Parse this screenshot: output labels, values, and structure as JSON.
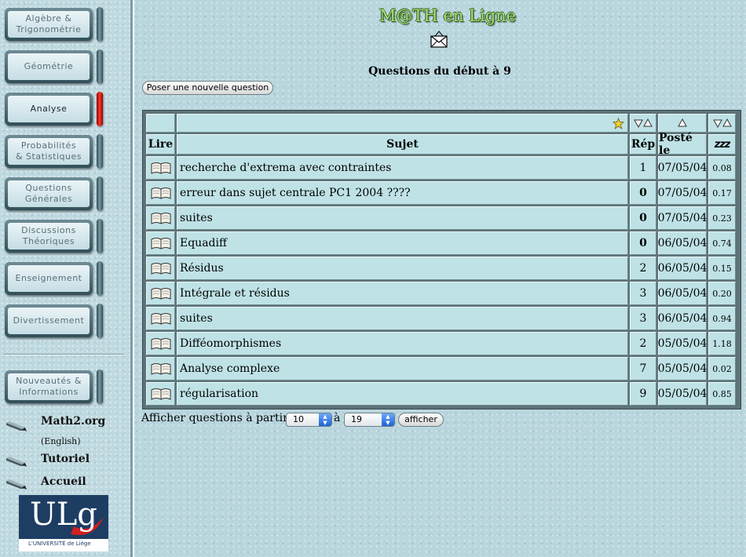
{
  "sidebar": {
    "items": [
      {
        "label": "Algèbre &\nTrigonométrie",
        "active": false
      },
      {
        "label": "Géométrie",
        "active": false
      },
      {
        "label": "Analyse",
        "active": true
      },
      {
        "label": "Probabilités\n& Statistiques",
        "active": false
      },
      {
        "label": "Questions\nGénérales",
        "active": false
      },
      {
        "label": "Discussions\nThéoriques",
        "active": false
      },
      {
        "label": "Enseignement",
        "active": false
      },
      {
        "label": "Divertissement",
        "active": false
      }
    ],
    "news": {
      "label": "Nouveautés &\nInformations"
    },
    "links": {
      "math2": "Math2.org",
      "math2_note": "(English)",
      "tutorial": "Tutoriel",
      "home": "Accueil"
    },
    "logo": {
      "text": "ULg",
      "caption": "L'UNIVERSITÉ de Liège"
    }
  },
  "header": {
    "site_title": "M@TH en Ligne",
    "questions_heading": "Questions du début à 9",
    "new_question_button": "Poser une nouvelle question"
  },
  "table": {
    "columns": {
      "read": "Lire",
      "subject": "Sujet",
      "replies": "Rép",
      "posted": "Posté le",
      "sleep": "zzz"
    },
    "rows": [
      {
        "subject": "recherche d'extrema avec contraintes",
        "replies": "1",
        "date": "07/05/04",
        "score": "0.08"
      },
      {
        "subject": "erreur dans sujet centrale PC1 2004 ????",
        "replies": "0",
        "date": "07/05/04",
        "score": "0.17"
      },
      {
        "subject": "suites",
        "replies": "0",
        "date": "07/05/04",
        "score": "0.23"
      },
      {
        "subject": "Equadiff",
        "replies": "0",
        "date": "06/05/04",
        "score": "0.74"
      },
      {
        "subject": "Résidus",
        "replies": "2",
        "date": "06/05/04",
        "score": "0.15"
      },
      {
        "subject": "Intégrale et résidus",
        "replies": "3",
        "date": "06/05/04",
        "score": "0.20"
      },
      {
        "subject": "suites",
        "replies": "3",
        "date": "06/05/04",
        "score": "0.94"
      },
      {
        "subject": "Difféomorphismes",
        "replies": "2",
        "date": "05/05/04",
        "score": "1.18"
      },
      {
        "subject": "Analyse complexe",
        "replies": "7",
        "date": "05/05/04",
        "score": "0.02"
      },
      {
        "subject": "régularisation",
        "replies": "9",
        "date": "05/05/04",
        "score": "0.85"
      }
    ]
  },
  "pagination": {
    "prefix": "Afficher questions à partir de",
    "from_value": "10",
    "separator": "à",
    "to_value": "19",
    "button": "afficher"
  },
  "colors": {
    "accent_active_tab": "#ff3a2a",
    "title_green": "#a8e07a",
    "table_cell": "#bfe2e6"
  }
}
